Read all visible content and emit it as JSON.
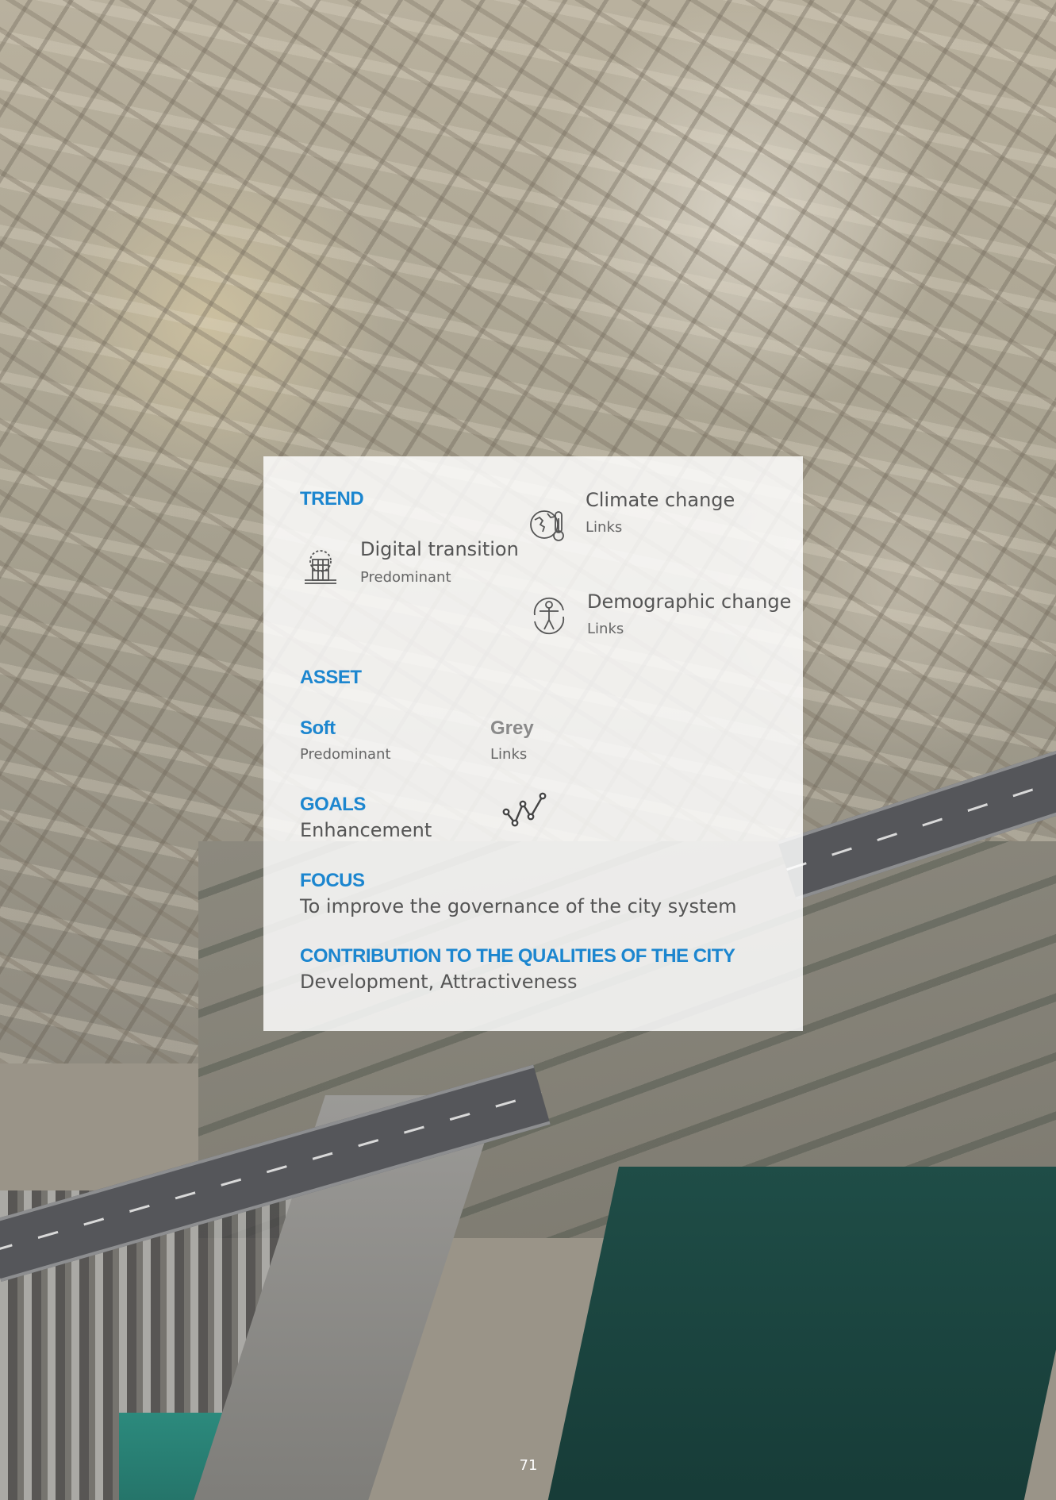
{
  "trend": {
    "heading": "TREND",
    "items": [
      {
        "title": "Digital transition",
        "level": "Predominant",
        "icon": "digital-building-icon"
      },
      {
        "title": "Climate change",
        "level": "Links",
        "icon": "climate-globe-thermometer-icon"
      },
      {
        "title": "Demographic change",
        "level": "Links",
        "icon": "demographic-person-icon"
      }
    ]
  },
  "asset": {
    "heading": "ASSET",
    "items": [
      {
        "title": "Soft",
        "level": "Predominant",
        "color": "#1c86cf"
      },
      {
        "title": "Grey",
        "level": "Links",
        "color": "#8a8a8a"
      }
    ]
  },
  "goals": {
    "heading": "GOALS",
    "value": "Enhancement",
    "icon": "trend-line-icon"
  },
  "focus": {
    "heading": "FOCUS",
    "value": "To improve the governance of the city system"
  },
  "contribution": {
    "heading": "CONTRIBUTION TO THE QUALITIES OF THE CITY",
    "value": "Development, Attractiveness"
  },
  "page_number": "71",
  "colors": {
    "accent": "#1c86cf",
    "text": "#555555",
    "card": "#ffffff"
  }
}
